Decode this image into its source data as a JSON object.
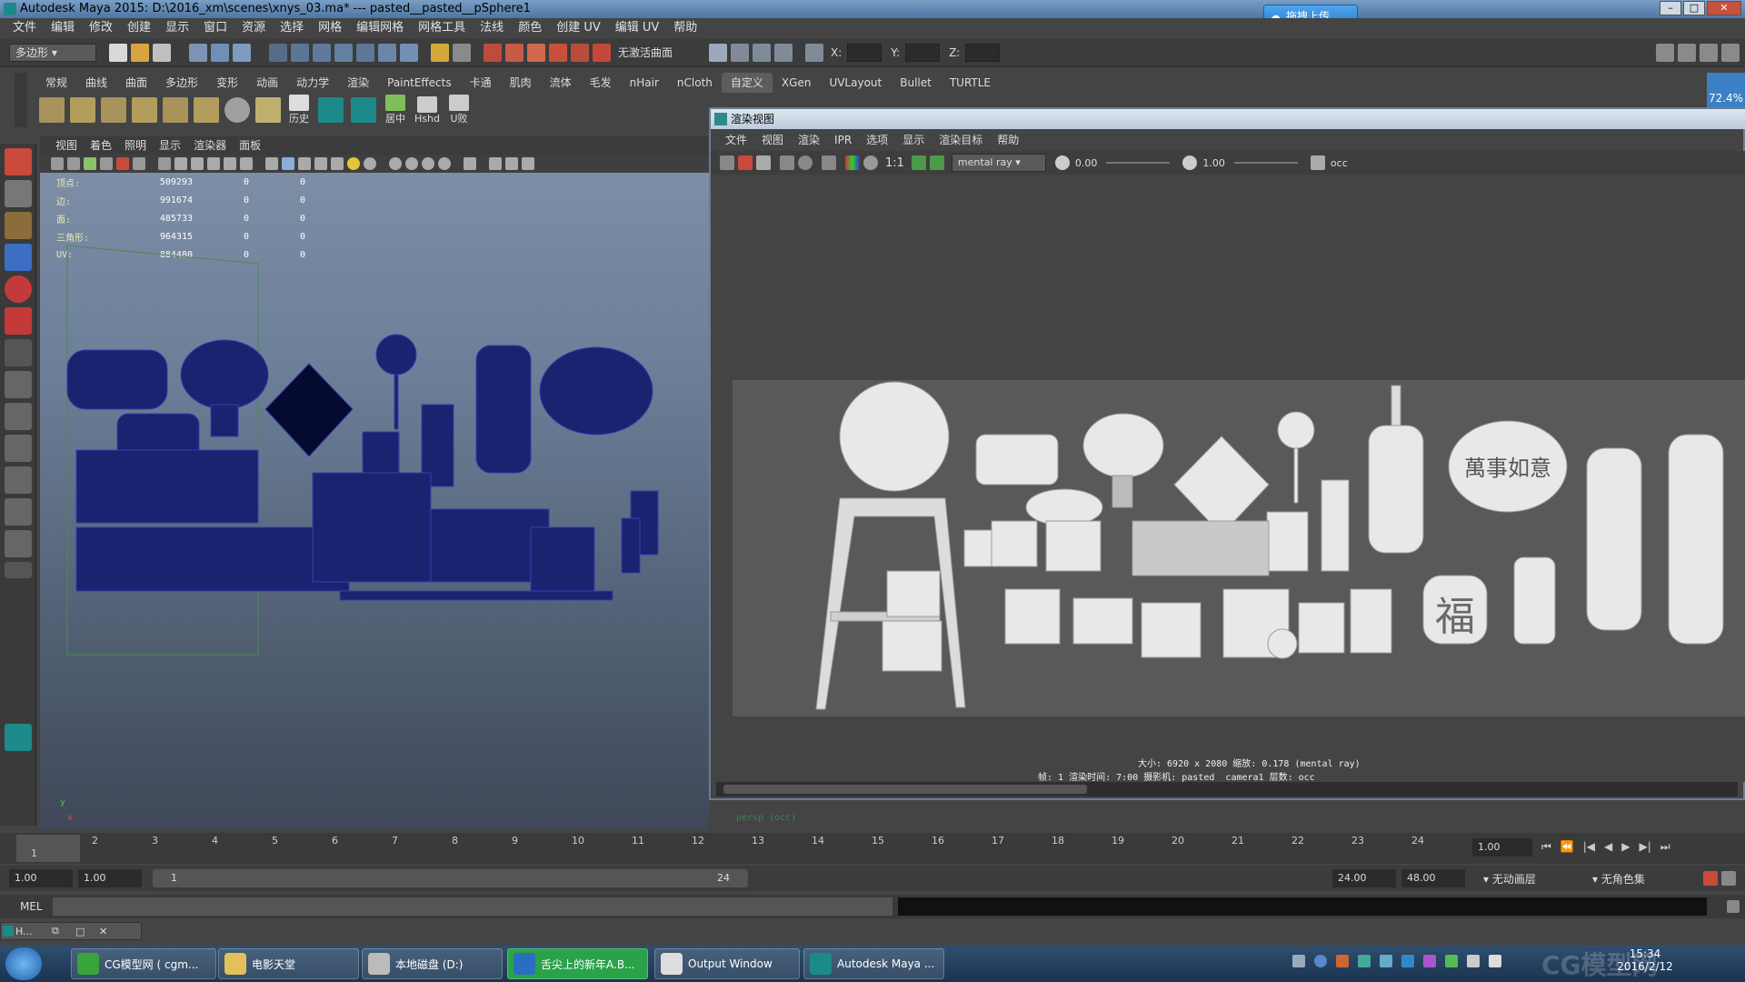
{
  "window": {
    "title": "Autodesk Maya 2015: D:\\2016_xm\\scenes\\xnys_03.ma*   ---   pasted__pasted__pSphere1"
  },
  "upload": {
    "label": "拖拽上传"
  },
  "menus": [
    "文件",
    "编辑",
    "修改",
    "创建",
    "显示",
    "窗口",
    "资源",
    "选择",
    "网格",
    "编辑网格",
    "网格工具",
    "法线",
    "颜色",
    "创建 UV",
    "编辑 UV",
    "帮助"
  ],
  "statusline": {
    "mode": "多边形",
    "live_label": "无激活曲面",
    "x": "X:",
    "y": "Y:",
    "z": "Z:"
  },
  "shelf": {
    "tabs": [
      "常规",
      "曲线",
      "曲面",
      "多边形",
      "变形",
      "动画",
      "动力学",
      "渲染",
      "PaintEffects",
      "卡通",
      "肌肉",
      "流体",
      "毛发",
      "nHair",
      "nCloth",
      "自定义",
      "XGen",
      "UVLayout",
      "Bullet",
      "TURTLE"
    ],
    "active": "自定义",
    "icon_labels": [
      "历史",
      "居中",
      "Hshd",
      "U败"
    ],
    "percent": "72.4%"
  },
  "viewport": {
    "menu": [
      "视图",
      "着色",
      "照明",
      "显示",
      "渲染器",
      "面板"
    ],
    "hud": [
      {
        "k": "顶点:",
        "v": "509293",
        "a": "0",
        "b": "0"
      },
      {
        "k": "边:",
        "v": "991674",
        "a": "0",
        "b": "0"
      },
      {
        "k": "面:",
        "v": "485733",
        "a": "0",
        "b": "0"
      },
      {
        "k": "三角形:",
        "v": "964315",
        "a": "0",
        "b": "0"
      },
      {
        "k": "UV:",
        "v": "884480",
        "a": "0",
        "b": "0"
      }
    ],
    "axis_y": "y",
    "axis_x": "x"
  },
  "render_window": {
    "title": "渲染视图",
    "menu": [
      "文件",
      "视图",
      "渲染",
      "IPR",
      "选项",
      "显示",
      "渲染目标",
      "帮助"
    ],
    "ratio": "1:1",
    "renderer": "mental ray",
    "exposure": "0.00",
    "gamma": "1.00",
    "layer": "occ",
    "lantern_text": "萬事如意",
    "fu_text": "福",
    "info_line1": "大小: 6920 x 2080  缩放: 0.178       (mental ray)",
    "info_line2": "帧: 1          渲染时间:  7:00          摄影机: pasted__camera1          层数: occ",
    "status": "persp (occ)"
  },
  "timeline": {
    "ticks": [
      "1",
      "2",
      "3",
      "4",
      "5",
      "6",
      "7",
      "8",
      "9",
      "10",
      "11",
      "12",
      "13",
      "14",
      "15",
      "16",
      "17",
      "18",
      "19",
      "20",
      "21",
      "22",
      "23",
      "24"
    ],
    "current": "1.00"
  },
  "range": {
    "start": "1.00",
    "inner_start": "1.00",
    "slider_start": "1",
    "slider_end": "24",
    "end": "24.00",
    "anim_end": "48.00",
    "layer": "无动画层",
    "char": "无角色集"
  },
  "mel": {
    "label": "MEL"
  },
  "minimized": {
    "label": "H..."
  },
  "taskbar": {
    "items": [
      "CG模型网 ( cgm...",
      "电影天堂",
      "本地磁盘 (D:)",
      "舌尖上的新年A.B...",
      "Output Window",
      "Autodesk Maya ..."
    ],
    "time": "15:34",
    "date": "2016/2/12"
  },
  "watermark": "CG模型网",
  "colors": {
    "accent": "#3b80c4",
    "wire": "#1a2370",
    "render_bg": "#595959"
  }
}
